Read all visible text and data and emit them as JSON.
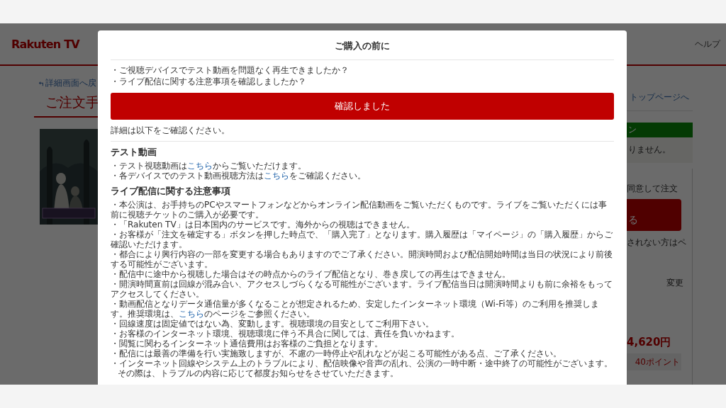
{
  "background_page": {
    "logo": "Rakuten TV",
    "help_link": "ヘルプ",
    "back_link": "詳細画面へ戻",
    "page_title": "ご注文手",
    "top_page_link": "トップページへ",
    "notice_header": "ン",
    "notice_text": "りません。",
    "agree_text": "同意して注文",
    "order_button": "る",
    "note_text": "されない方はペ",
    "change_link": "変更",
    "price": "4,620円",
    "points": "40ポイント"
  },
  "modal": {
    "title": "ご購入の前に",
    "questions": [
      "・ご視聴デバイスでテスト動画を問題なく再生できましたか？",
      "・ライブ配信に関する注意事項を確認しましたか？"
    ],
    "confirm_button": "確認しました",
    "detail_note": "詳細は以下をご確認ください。",
    "sections": [
      {
        "heading": "テスト動画",
        "items": [
          [
            {
              "text": "・テスト視聴動画は",
              "link": false
            },
            {
              "text": "こちら",
              "link": true
            },
            {
              "text": "からご覧いただけます。",
              "link": false
            }
          ],
          [
            {
              "text": "・各デバイスでのテスト動画視聴方法は",
              "link": false
            },
            {
              "text": "こちら",
              "link": true
            },
            {
              "text": "をご確認ください。",
              "link": false
            }
          ]
        ]
      },
      {
        "heading": "ライブ配信に関する注意事項",
        "items": [
          [
            {
              "text": "・本公演は、お手持ちのPCやスマートフォンなどからオンライン配信動画をご覧いただくものです。ライブをご覧いただくには事前に視聴チケットのご購入が必要です。",
              "link": false
            }
          ],
          [
            {
              "text": "・「Rakuten TV」は日本国内のサービスです。海外からの視聴はできません。",
              "link": false
            }
          ],
          [
            {
              "text": "・お客様が「注文を確定する」ボタンを押した時点で、「購入完了」となります。購入履歴は「マイページ」の「購入履歴」からご確認いただけます。",
              "link": false
            }
          ],
          [
            {
              "text": "・都合により興行内容の一部を変更する場合もありますのでご了承ください。開演時間および配信開始時間は当日の状況により前後する可能性がございます。",
              "link": false
            }
          ],
          [
            {
              "text": "・配信中に途中から視聴した場合はその時点からのライブ配信となり、巻き戻しての再生はできません。",
              "link": false
            }
          ],
          [
            {
              "text": "・開演時間直前は回線が混み合い、アクセスしづらくなる可能性がございます。ライブ配信当日は開演時間よりも前に余裕をもってアクセスしてください。",
              "link": false
            }
          ],
          [
            {
              "text": "・動画配信となりデータ通信量が多くなることが想定されるため、安定したインターネット環境（Wi-Fi等）のご利用を推奨します。推奨環境は、",
              "link": false
            },
            {
              "text": "こちら",
              "link": true
            },
            {
              "text": "のページをご参照ください。",
              "link": false
            }
          ],
          [
            {
              "text": "・回線速度は固定値ではない為、変動します。視聴環境の目安としてご利用下さい。",
              "link": false
            }
          ],
          [
            {
              "text": "・お客様のインターネット環境、視聴環境に伴う不具合に関しては、責任を負いかねます。",
              "link": false
            }
          ],
          [
            {
              "text": "・閲覧に関わるインターネット通信費用はお客様のご負担となります。",
              "link": false
            }
          ],
          [
            {
              "text": "・配信には最善の準備を行い実施致しますが、不慮の一時停止や乱れなどが起こる可能性がある点、ご了承ください。",
              "link": false
            }
          ],
          [
            {
              "text": "・インターネット回線やシステム上のトラブルにより、配信映像や音声の乱れ、公演の一時中断・途中終了の可能性がございます。",
              "link": false
            }
          ],
          [
            {
              "text": "その際は、トラブルの内容に応じて都度お知らせをさせていただきます。",
              "link": false
            }
          ]
        ]
      }
    ]
  }
}
